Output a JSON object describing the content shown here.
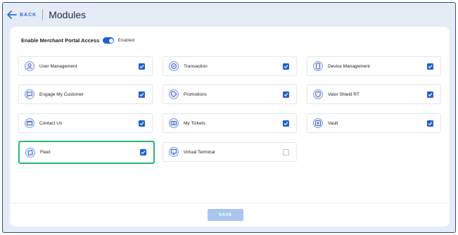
{
  "header": {
    "back_label": "BACK",
    "title": "Modules"
  },
  "access": {
    "label": "Enable Merchant Portal Access",
    "status": "Enabled",
    "enabled": true
  },
  "modules": [
    {
      "label": "User Management",
      "icon": "user-icon",
      "checked": true
    },
    {
      "label": "Transaction",
      "icon": "transaction-icon",
      "checked": true
    },
    {
      "label": "Device Management",
      "icon": "device-icon",
      "checked": true
    },
    {
      "label": "Engage My Customer",
      "icon": "chat-icon",
      "checked": true
    },
    {
      "label": "Promotions",
      "icon": "tag-icon",
      "checked": true
    },
    {
      "label": "Valor Shield RT",
      "icon": "shield-icon",
      "checked": true
    },
    {
      "label": "Contact Us",
      "icon": "mail-icon",
      "checked": true
    },
    {
      "label": "My Tickets",
      "icon": "ticket-icon",
      "checked": true
    },
    {
      "label": "Vault",
      "icon": "vault-icon",
      "checked": true
    },
    {
      "label": "Fleet",
      "icon": "fleet-icon",
      "checked": true
    },
    {
      "label": "Virtual Terminal",
      "icon": "terminal-icon",
      "checked": false
    }
  ],
  "footer": {
    "save_label": "SAVE"
  },
  "colors": {
    "accent": "#1f5fd6",
    "highlight_border": "#2bb573",
    "save_disabled": "#a9c6f0"
  }
}
